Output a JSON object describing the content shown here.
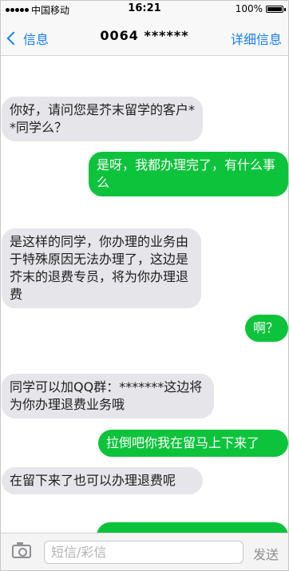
{
  "status_bar": {
    "carrier": "中国移动",
    "time": "16:21",
    "battery": "100%",
    "signal_icon": "signal-dots-icon",
    "battery_icon": "battery-icon"
  },
  "nav": {
    "back_label": "信息",
    "title": "0064 ******",
    "detail_label": "详细信息"
  },
  "messages": [
    {
      "direction": "incoming",
      "text": "你好，请问您是芥末留学的客户**同学么？"
    },
    {
      "direction": "outgoing",
      "text": "是呀，我都办理完了，有什么事么"
    },
    {
      "direction": "incoming",
      "text": "是这样的同学，你办理的业务由于特殊原因无法办理了，这边是芥末的退费专员，将为你办理退费"
    },
    {
      "direction": "outgoing",
      "text": "啊？"
    },
    {
      "direction": "incoming",
      "text": "同学可以加QQ群：*******这边将为你办理退费业务哦"
    },
    {
      "direction": "outgoing",
      "text": "拉倒吧你我在留马上下来了"
    },
    {
      "direction": "incoming",
      "text": "在留下来了也可以办理退费呢"
    }
  ],
  "composer": {
    "placeholder": "短信/彩信",
    "send_label": "发送",
    "camera_icon": "camera-icon"
  },
  "colors": {
    "ios_blue": "#1a7dfa",
    "incoming_bubble": "#e5e5ea",
    "outgoing_bubble": "#0dc33c"
  }
}
